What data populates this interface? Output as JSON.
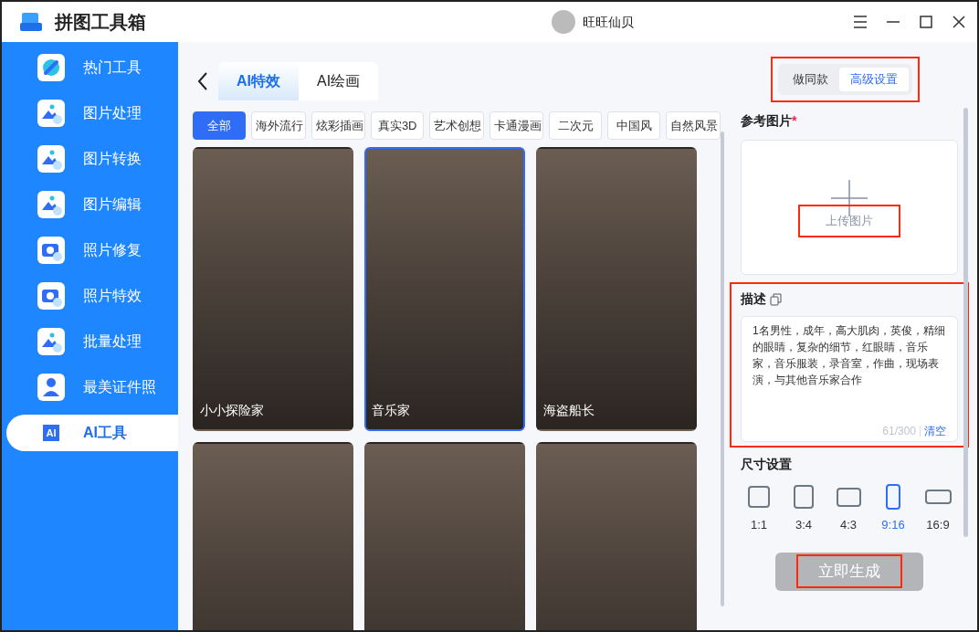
{
  "window": {
    "title": "拼图工具箱",
    "user": "旺旺仙贝"
  },
  "sidebar": {
    "items": [
      {
        "label": "热门工具",
        "selected": false
      },
      {
        "label": "图片处理",
        "selected": false
      },
      {
        "label": "图片转换",
        "selected": false
      },
      {
        "label": "图片编辑",
        "selected": false
      },
      {
        "label": "照片修复",
        "selected": false
      },
      {
        "label": "照片特效",
        "selected": false
      },
      {
        "label": "批量处理",
        "selected": false
      },
      {
        "label": "最美证件照",
        "selected": false
      },
      {
        "label": "AI工具",
        "icon_text": "AI",
        "selected": true
      }
    ]
  },
  "tabs": [
    {
      "label": "AI特效",
      "selected": true
    },
    {
      "label": "AI绘画",
      "selected": false
    }
  ],
  "categories": [
    {
      "label": "全部",
      "selected": true
    },
    {
      "label": "海外流行",
      "selected": false
    },
    {
      "label": "炫彩插画",
      "selected": false
    },
    {
      "label": "真实3D",
      "selected": false
    },
    {
      "label": "艺术创想",
      "selected": false
    },
    {
      "label": "卡通漫画",
      "selected": false
    },
    {
      "label": "二次元",
      "selected": false
    },
    {
      "label": "中国风",
      "selected": false
    },
    {
      "label": "自然风景",
      "selected": false
    }
  ],
  "cards": [
    {
      "caption": "小小探险家",
      "selected": false
    },
    {
      "caption": "音乐家",
      "selected": true
    },
    {
      "caption": "海盗船长",
      "selected": false
    },
    {
      "selected": false
    },
    {
      "selected": false
    },
    {
      "selected": false
    }
  ],
  "panel": {
    "modes": [
      {
        "label": "做同款",
        "selected": false
      },
      {
        "label": "高级设置",
        "selected": true
      }
    ],
    "modes_highlighted": true,
    "reference_label": "参考图片",
    "required_mark": "*",
    "upload_label": "上传图片",
    "upload_highlighted": true,
    "description_label": "描述",
    "description": "1名男性，成年，高大肌肉，英俊，精细的眼睛，复杂的细节，红眼睛，音乐家，音乐服装，录音室，作曲，现场表演，与其他音乐家合作",
    "counter": "61/300",
    "clear": "清空",
    "description_highlighted": true,
    "size_label": "尺寸设置",
    "sizes": [
      {
        "label": "1:1",
        "selected": false
      },
      {
        "label": "3:4",
        "selected": false
      },
      {
        "label": "4:3",
        "selected": false
      },
      {
        "label": "9:16",
        "selected": true
      },
      {
        "label": "16:9",
        "selected": false
      }
    ],
    "generate": "立即生成",
    "generate_highlighted": true
  }
}
